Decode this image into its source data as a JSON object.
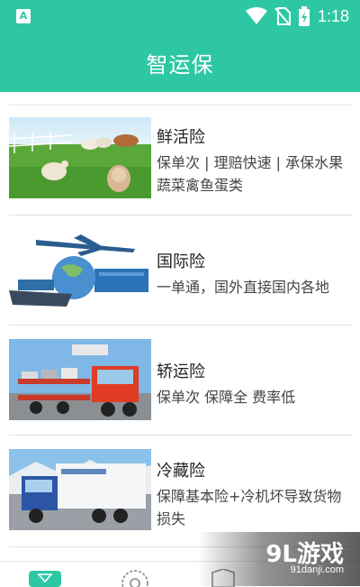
{
  "status_bar": {
    "time": "1:18",
    "icons": [
      "wifi-icon",
      "no-sim-icon",
      "battery-charging-icon"
    ]
  },
  "header": {
    "title": "智运保"
  },
  "items": [
    {
      "title": "鲜活险",
      "desc": "保单次 | 理赔快速 | 承保水果蔬菜禽鱼蛋类",
      "image": "livestock-photo"
    },
    {
      "title": "国际险",
      "desc": "一单通，国外直接国内各地",
      "image": "global-logistics-photo"
    },
    {
      "title": "轿运险",
      "desc": "保单次 保障全 费率低",
      "image": "car-carrier-truck-photo"
    },
    {
      "title": "冷藏险",
      "desc": "保障基本险+冷机坏导致货物损失",
      "image": "refrigerated-truck-photo"
    }
  ],
  "watermark": {
    "logo": "9L游戏",
    "url": "91danji.com"
  },
  "colors": {
    "brand": "#2ec7a3"
  }
}
